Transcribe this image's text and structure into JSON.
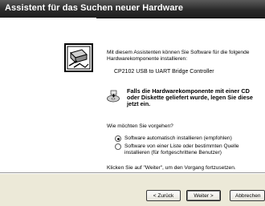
{
  "window": {
    "title": "Assistent für das Suchen neuer Hardware"
  },
  "intro": {
    "line1": "Mit diesem Assistenten können Sie Software für die folgende",
    "line2": "Hardwarekomponente installieren:"
  },
  "device_name": "CP2102 USB to UART Bridge Controller",
  "warning": {
    "line1": "Falls die Hardwarekomponente mit einer CD",
    "line2": "oder Diskette geliefert wurde, legen Sie diese",
    "line3": "jetzt ein."
  },
  "question": "Wie möchten Sie vorgehen?",
  "options": [
    {
      "line1": "Software automatisch installieren (empfohlen)",
      "selected": true
    },
    {
      "line1": "Software von einer Liste oder bestimmten Quelle",
      "line2": "installieren (für fortgeschrittene Benutzer)",
      "selected": false
    }
  ],
  "footer_hint": "Klicken Sie auf \"Weiter\", um den Vorgang fortzusetzen.",
  "buttons": {
    "back": "< Zurück",
    "next": "Weiter >",
    "cancel": "Abbrechen"
  },
  "icons": {
    "wizard": "hardware-wizard-icon",
    "cd": "cd-disc-icon"
  }
}
